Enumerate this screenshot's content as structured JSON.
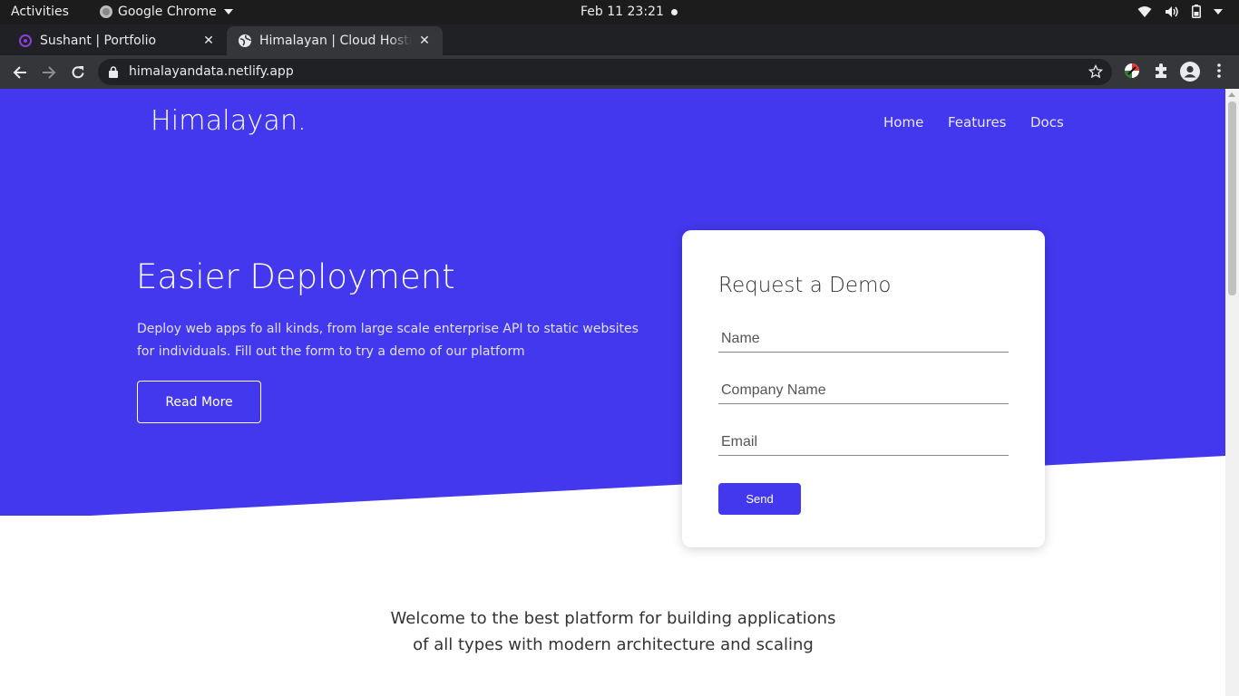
{
  "system_bar": {
    "activities": "Activities",
    "app_name": "Google Chrome",
    "clock": "Feb 11  23:21"
  },
  "browser": {
    "tabs": [
      {
        "title": "Sushant | Portfolio",
        "active": false
      },
      {
        "title": "Himalayan | Cloud Hosting",
        "active": true
      }
    ],
    "url": "himalayandata.netlify.app"
  },
  "page": {
    "brand": "Himalayan.",
    "nav": {
      "home": "Home",
      "features": "Features",
      "docs": "Docs"
    },
    "hero": {
      "title": "Easier Deployment",
      "text": "Deploy web apps fo all kinds, from large scale enterprise API to static websites for individuals. Fill out the form to try a demo of our platform",
      "read_more": "Read More"
    },
    "demo_form": {
      "title": "Request a Demo",
      "name_placeholder": "Name",
      "company_placeholder": "Company Name",
      "email_placeholder": "Email",
      "send_label": "Send"
    },
    "welcome": "Welcome to the best platform for building applications of all types with modern architecture and scaling"
  },
  "colors": {
    "brand_primary": "#4338ed",
    "text_dark": "#333333",
    "chrome_dark": "#202124",
    "chrome_toolbar": "#35363a"
  },
  "icons": {
    "system": [
      "wifi-icon",
      "volume-icon",
      "battery-icon",
      "system-menu-caret-icon"
    ],
    "toolbar": [
      "back-icon",
      "forward-icon",
      "reload-icon",
      "lock-icon",
      "bookmark-star-icon",
      "extension-color-icon",
      "extensions-puzzle-icon",
      "profile-avatar-icon",
      "chrome-menu-icon"
    ]
  }
}
